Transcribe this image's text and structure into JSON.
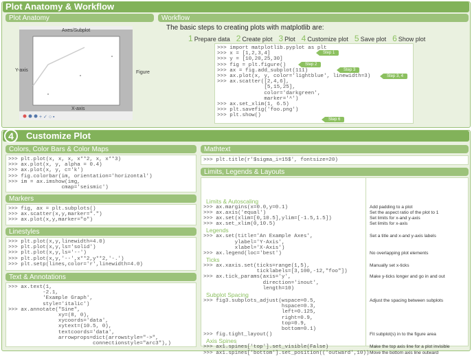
{
  "top": {
    "title": "Plot Anatomy & Workflow",
    "anatomy": {
      "header": "Plot Anatomy",
      "axes_label": "Axes/Subplot",
      "yaxis_label": "Y-axis",
      "xaxis_label": "X-axis",
      "figure_label": "Figure"
    },
    "workflow": {
      "header": "Workflow",
      "intro": "The basic steps to creating plots with matplotlib are:",
      "steps": [
        {
          "n": "1",
          "label": "Prepare data"
        },
        {
          "n": "2",
          "label": "Create plot"
        },
        {
          "n": "3",
          "label": "Plot"
        },
        {
          "n": "4",
          "label": "Customize plot"
        },
        {
          "n": "5",
          "label": "Save plot"
        },
        {
          "n": "6",
          "label": "Show plot"
        }
      ],
      "code": [
        ">>> import matplotlib.pyplot as plt",
        ">>> x = [1,2,3,4]",
        ">>> y = [10,20,25,30]",
        ">>> fig = plt.figure()",
        ">>> ax = fig.add_subplot(111)",
        ">>> ax.plot(x, y, color='lightblue', linewidth=3)",
        ">>> ax.scatter([2,4,6],",
        "               [5,15,25],",
        "               color='darkgreen',",
        "               marker='^')",
        ">>> ax.set_xlim(1, 6.5)",
        ">>> plt.savefig('foo.png')",
        ">>> plt.show()"
      ],
      "tags": [
        "Step 1",
        "Step 2",
        "Step 3",
        "Step 3, 4",
        "Step 6"
      ]
    }
  },
  "customize": {
    "number": "4",
    "title": "Customize Plot",
    "colors": {
      "header": "Colors, Color Bars & Color Maps",
      "code": [
        ">>> plt.plot(x, x, x, x**2, x, x**3)",
        ">>> ax.plot(x, y, alpha = 0.4)",
        ">>> ax.plot(x, y, c='k')",
        ">>> fig.colorbar(im, orientation='horizontal')",
        ">>> im = ax.imshow(img,",
        "                 cmap='seismic')"
      ]
    },
    "markers": {
      "header": "Markers",
      "code": [
        ">>> fig, ax = plt.subplots()",
        ">>> ax.scatter(x,y,marker=\".\")",
        ">>> ax.plot(x,y,marker=\"o\")"
      ]
    },
    "linestyles": {
      "header": "Linestyles",
      "code": [
        ">>> plt.plot(x,y,linewidth=4.0)",
        ">>> plt.plot(x,y,ls='solid')",
        ">>> plt.plot(x,y,ls='--')",
        ">>> plt.plot(x,y,'--',x**2,y**2,'-.')",
        ">>> plt.setp(lines,color='r',linewidth=4.0)"
      ]
    },
    "text": {
      "header": "Text & Annotations",
      "code": [
        ">>> ax.text(1,",
        "           -2.1,",
        "           'Example Graph',",
        "           style='italic')",
        ">>> ax.annotate(\"Sine\",",
        "                xy=(8, 0),",
        "                xycoords='data',",
        "                xytext=(10.5, 0),",
        "                textcoords='data',",
        "                arrowprops=dict(arrowstyle=\"->\",",
        "                           connectionstyle=\"arc3\"),)"
      ]
    },
    "mathtext": {
      "header": "Mathtext",
      "code": [
        ">>> plt.title(r'$sigma_i=15$', fontsize=20)"
      ]
    },
    "limits": {
      "header": "Limits, Legends & Layouts",
      "groups": [
        {
          "title": "Limits & Autoscaling",
          "items": [
            {
              "code": [
                ">>> ax.margins(x=0.0,y=0.1)"
              ],
              "desc": "Add padding to a plot"
            },
            {
              "code": [
                ">>> ax.axis('equal')"
              ],
              "desc": "Set the aspect ratio of the plot to 1"
            },
            {
              "code": [
                ">>> ax.set(xlim=[0,10.5],ylim=[-1.5,1.5])"
              ],
              "desc": "Set limits for x-and y-axis"
            },
            {
              "code": [
                ">>> ax.set_xlim(0,10.5)"
              ],
              "desc": "Set limits for x-axis"
            }
          ]
        },
        {
          "title": "Legends",
          "items": [
            {
              "code": [
                ">>> ax.set(title='An Example Axes',",
                "          ylabel='Y-Axis',",
                "          xlabel='X-Axis')"
              ],
              "desc": "Set a title and x-and y-axis labels"
            },
            {
              "code": [
                ">>> ax.legend(loc='best')"
              ],
              "desc": "No overlapping plot elements"
            }
          ]
        },
        {
          "title": "Ticks",
          "items": [
            {
              "code": [
                ">>> ax.xaxis.set(ticks=range(1,5),",
                "                 ticklabels=[3,100,-12,\"foo\"])"
              ],
              "desc": "Manually set x-ticks"
            },
            {
              "code": [
                ">>> ax.tick_params(axis='y',",
                "                   direction='inout',",
                "                   length=10)"
              ],
              "desc": "Make y-ticks longer and go in and out"
            }
          ]
        },
        {
          "title": "Subplot Spacing",
          "items": [
            {
              "code": [
                ">>> fig3.subplots_adjust(wspace=0.5,",
                "                         hspace=0.3,",
                "                         left=0.125,",
                "                         right=0.9,",
                "                         top=0.9,",
                "                         bottom=0.1)"
              ],
              "desc": "Adjust the spacing between subplots"
            },
            {
              "code": [
                ">>> fig.tight_layout()"
              ],
              "desc": "Fit subplot(s) in to the figure area"
            }
          ]
        },
        {
          "title": "Axis Spines",
          "items": [
            {
              "code": [
                ">>> ax1.spines['top'].set_visible(False)"
              ],
              "desc": "Make the top axis line for a plot invisible"
            },
            {
              "code": [
                ">>> ax1.spines['bottom'].set_position(('outward',10))"
              ],
              "desc": "Move the bottom axis line outward"
            }
          ]
        }
      ]
    }
  },
  "colors": {
    "accent": "#82b25a",
    "header": "#9cc27a",
    "panel": "#eaf1e0"
  }
}
